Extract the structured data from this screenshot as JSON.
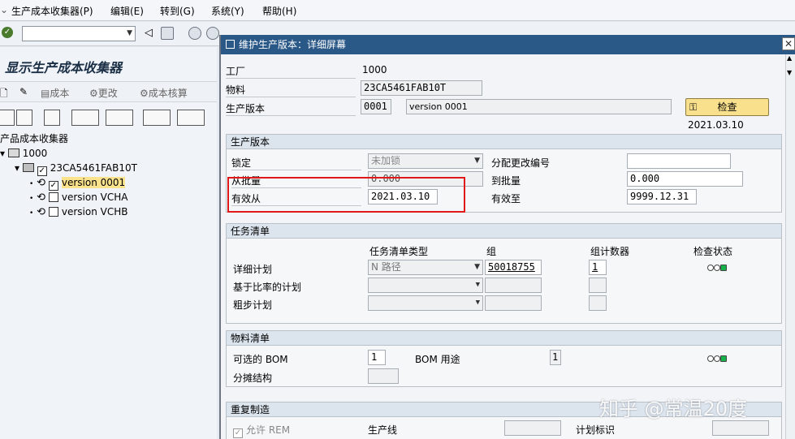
{
  "menubar": {
    "items": [
      "生产成本收集器(P)",
      "编辑(E)",
      "转到(G)",
      "系统(Y)",
      "帮助(H)"
    ]
  },
  "left_panel": {
    "title": "显示生产成本收集器",
    "tools": [
      "成本",
      "更改",
      "成本核算"
    ],
    "tree": {
      "root_label": "产品成本收集器",
      "plant": "1000",
      "material": "23CA5461FAB10T",
      "versions": [
        {
          "label": "version 0001",
          "checked": true,
          "selected": true
        },
        {
          "label": "version VCHA",
          "checked": false,
          "selected": false
        },
        {
          "label": "version VCHB",
          "checked": false,
          "selected": false
        }
      ]
    }
  },
  "dialog": {
    "title": "维护生产版本：详细屏幕",
    "close_label": "✕",
    "header": {
      "plant_label": "工厂",
      "plant_value": "1000",
      "material_label": "物料",
      "material_value": "23CA5461FAB10T",
      "version_label": "生产版本",
      "version_value": "0001",
      "version_text": "version 0001",
      "check_button": "检查",
      "check_date": "2021.03.10"
    },
    "prod_version": {
      "title": "生产版本",
      "lock_label": "锁定",
      "lock_value": "未加锁",
      "change_no_label": "分配更改编号",
      "change_no_value": "",
      "from_lot_label": "从批量",
      "from_lot_value": "0.000",
      "to_lot_label": "到批量",
      "to_lot_value": "0.000",
      "valid_from_label": "有效从",
      "valid_from_value": "2021.03.10",
      "valid_to_label": "有效至",
      "valid_to_value": "9999.12.31"
    },
    "task_list": {
      "title": "任务清单",
      "col_type": "任务清单类型",
      "col_group": "组",
      "col_counter": "组计数器",
      "col_status": "检查状态",
      "rows": [
        {
          "label": "详细计划",
          "type": "N 路径",
          "group": "50018755",
          "counter": "1"
        },
        {
          "label": "基于比率的计划",
          "type": "",
          "group": "",
          "counter": ""
        },
        {
          "label": "粗步计划",
          "type": "",
          "group": "",
          "counter": ""
        }
      ]
    },
    "bom": {
      "title": "物料清单",
      "alt_bom_label": "可选的 BOM",
      "alt_bom_value": "1",
      "bom_usage_label": "BOM 用途",
      "bom_usage_value": "1",
      "apportion_label": "分摊结构",
      "apportion_value": ""
    },
    "rem": {
      "title": "重复制造",
      "allow_rem_label": "允许 REM",
      "line_label": "生产线",
      "line_value": "",
      "plan_id_label": "计划标识",
      "plan_id_value": ""
    }
  },
  "watermark": "知乎 @常温20度",
  "colors": {
    "title_bar": "#2a5887",
    "highlight_box": "#e01818",
    "selected_row": "#fbe28c",
    "status_green": "#18b24a"
  }
}
